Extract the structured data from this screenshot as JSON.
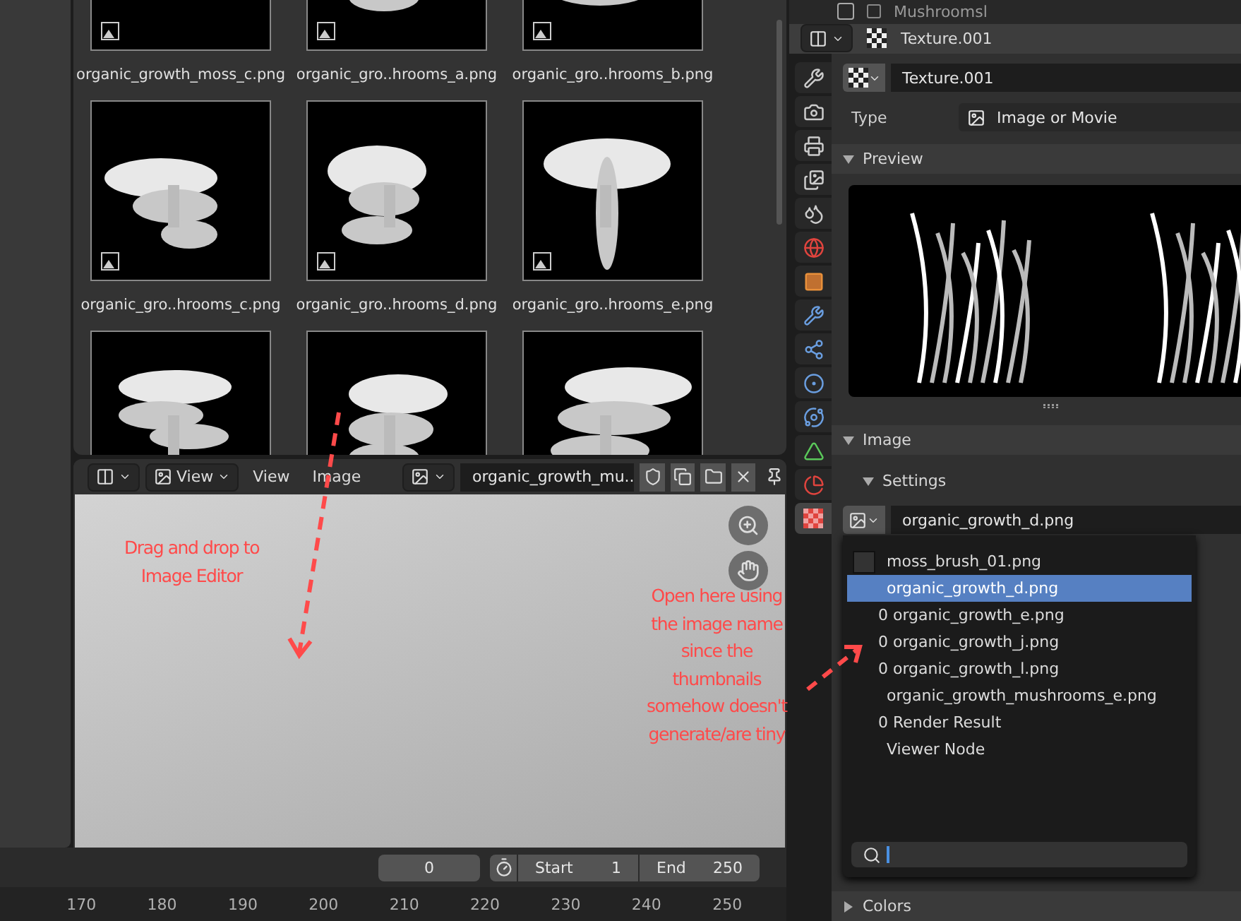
{
  "file_browser": {
    "items": [
      {
        "kind": "picture",
        "label": "organic_growth_moss_c.png"
      },
      {
        "kind": "picture",
        "label": "organic_gro..hrooms_a.png"
      },
      {
        "kind": "picture",
        "label": "organic_gro..hrooms_b.png"
      },
      {
        "kind": "picture",
        "label": "organic_gro..hrooms_c.png"
      },
      {
        "kind": "picture",
        "label": "organic_gro..hrooms_d.png"
      },
      {
        "kind": "picture",
        "label": "organic_gro..hrooms_e.png"
      },
      {
        "kind": "picture"
      },
      {
        "kind": "picture"
      },
      {
        "kind": "picture"
      }
    ]
  },
  "image_editor": {
    "view_dropdown": "View",
    "menus": [
      "View",
      "Image"
    ],
    "image_name": "organic_growth_mu.."
  },
  "timeline": {
    "current_frame": "0",
    "start_label": "Start",
    "start": "1",
    "end_label": "End",
    "end": "250",
    "ruler": [
      "170",
      "180",
      "190",
      "200",
      "210",
      "220",
      "230",
      "240",
      "250"
    ]
  },
  "outliner": {
    "item": "Mushroomsl",
    "checked": false
  },
  "properties": {
    "header_title": "Texture.001",
    "tabs": [
      {
        "kind": "tool",
        "selected": false
      },
      {
        "kind": "render",
        "selected": false
      },
      {
        "kind": "output",
        "selected": false
      },
      {
        "kind": "view_layer",
        "selected": false
      },
      {
        "kind": "scene",
        "selected": false
      },
      {
        "kind": "world",
        "selected": false
      },
      {
        "kind": "object",
        "selected": false
      },
      {
        "kind": "modifier",
        "selected": false
      },
      {
        "kind": "particles",
        "selected": false
      },
      {
        "kind": "physics",
        "selected": false
      },
      {
        "kind": "constraints",
        "selected": false
      },
      {
        "kind": "data",
        "selected": false
      },
      {
        "kind": "material",
        "selected": false
      },
      {
        "kind": "texture",
        "selected": true
      }
    ],
    "texture_field": "Texture.001",
    "type_label": "Type",
    "type_value": "Image or Movie",
    "preview_panel": {
      "title": "Preview",
      "expanded": true
    },
    "image_panel": {
      "title": "Image",
      "expanded": true
    },
    "settings_panel": {
      "title": "Settings",
      "expanded": true
    },
    "image_field": "organic_growth_d.png",
    "colors_panel": {
      "title": "Colors",
      "expanded": false
    }
  },
  "image_menu": {
    "items": [
      {
        "kind": "thumb",
        "label": "moss_brush_01.png",
        "selected": false
      },
      {
        "kind": "named",
        "label": "organic_growth_d.png",
        "selected": true
      },
      {
        "kind": "count",
        "label": "0 organic_growth_e.png",
        "selected": false
      },
      {
        "kind": "count",
        "label": "0 organic_growth_j.png",
        "selected": false
      },
      {
        "kind": "count",
        "label": "0 organic_growth_l.png",
        "selected": false
      },
      {
        "kind": "named",
        "label": "organic_growth_mushrooms_e.png",
        "selected": false
      },
      {
        "kind": "count",
        "label": "0 Render Result",
        "selected": false
      },
      {
        "kind": "named",
        "label": "Viewer Node",
        "selected": false
      }
    ]
  },
  "annotations": [
    {
      "lines": [
        "Drag and drop to",
        "Image Editor"
      ]
    },
    {
      "lines": [
        "Open here using",
        "the image name",
        "since the",
        "thumbnails",
        "somehow doesn't",
        "generate/are tiny"
      ]
    }
  ]
}
